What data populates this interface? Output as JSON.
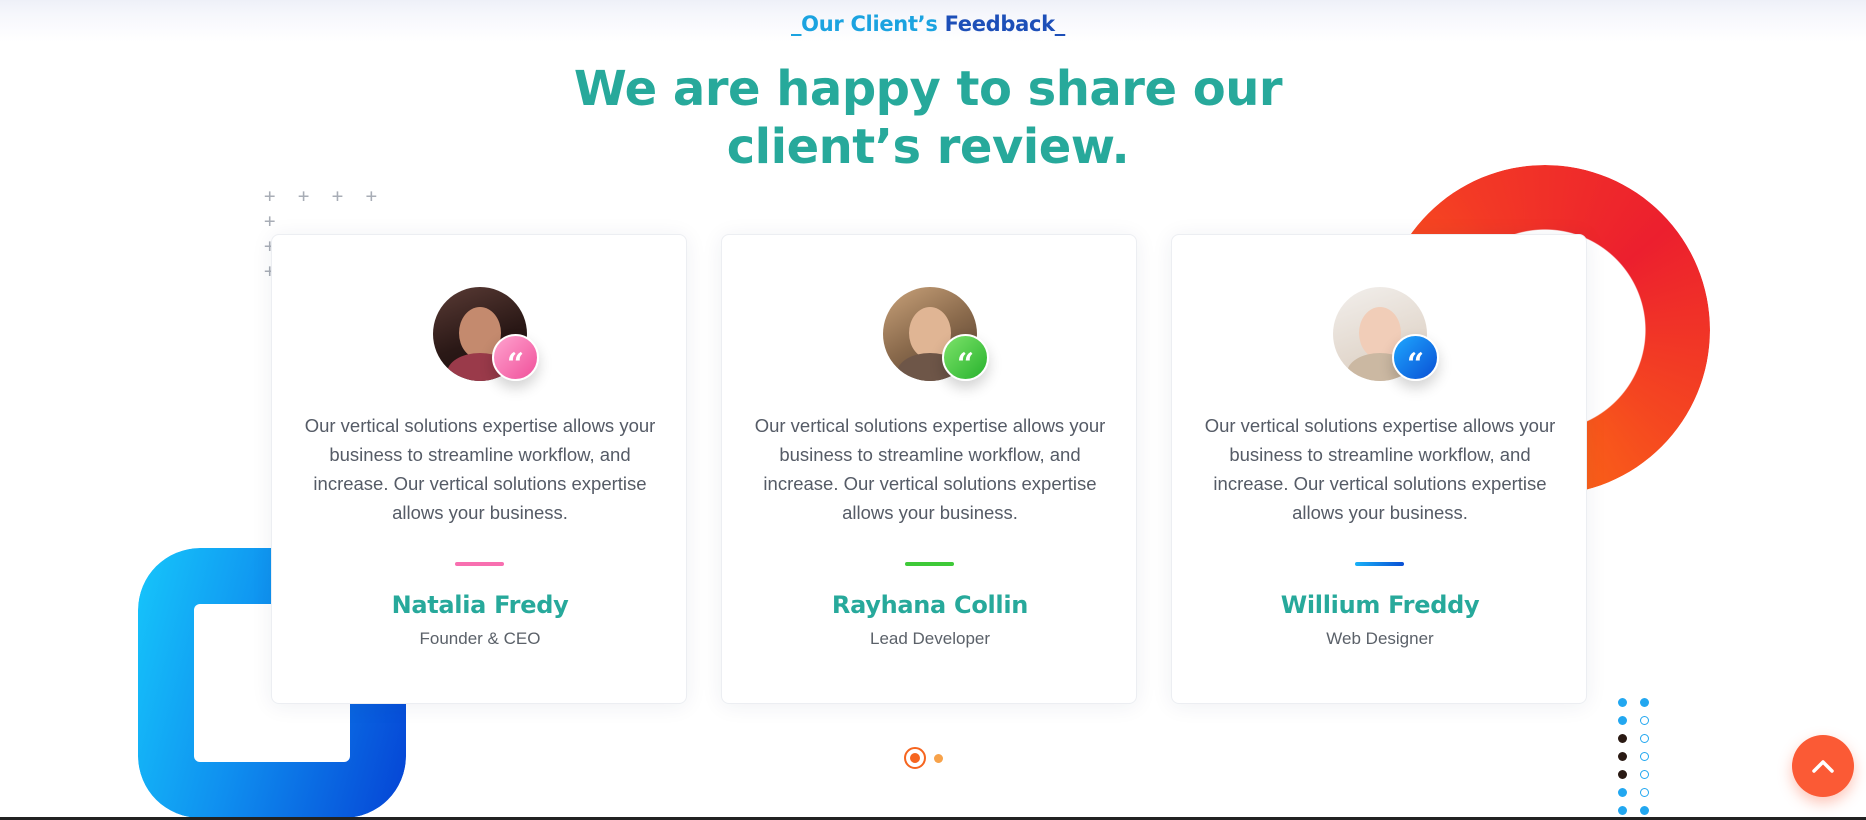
{
  "section": {
    "subtitle_part1": "_Our Client’s ",
    "subtitle_part2": "Feedback_",
    "heading_line1": "We are happy to share our",
    "heading_line2": "client’s review."
  },
  "decor": {
    "plus_grid_rows": [
      "+ + + + +",
      "+ + + + +"
    ]
  },
  "testimonials": [
    {
      "text": "Our vertical solutions expertise allows your business to streamline workflow, and increase. Our vertical solutions expertise allows your business.",
      "name": "Natalia Fredy",
      "role": "Founder & CEO",
      "quote_icon": "quote-icon",
      "quote_glyph": "“",
      "accent_color": "#f86fb0"
    },
    {
      "text": "Our vertical solutions expertise allows your business to streamline workflow, and increase. Our vertical solutions expertise allows your business.",
      "name": "Rayhana Collin",
      "role": "Lead Developer",
      "quote_icon": "quote-icon",
      "quote_glyph": "“",
      "accent_color": "#3ec938"
    },
    {
      "text": "Our vertical solutions expertise allows your business to streamline workflow, and increase. Our vertical solutions expertise allows your business.",
      "name": "Willium Freddy",
      "role": "Web Designer",
      "quote_icon": "quote-icon",
      "quote_glyph": "“",
      "accent_color": "#0a7ae8"
    }
  ],
  "pagination": {
    "pages": 2,
    "active_page": 1,
    "active_color": "#f6651f"
  },
  "colors": {
    "heading": "#27a99b",
    "subtitle_light": "#1ba3e0",
    "subtitle_dark": "#1d4fb8",
    "scroll_top": "#fb5a35"
  },
  "scroll_top_icon": "chevron-up-icon"
}
